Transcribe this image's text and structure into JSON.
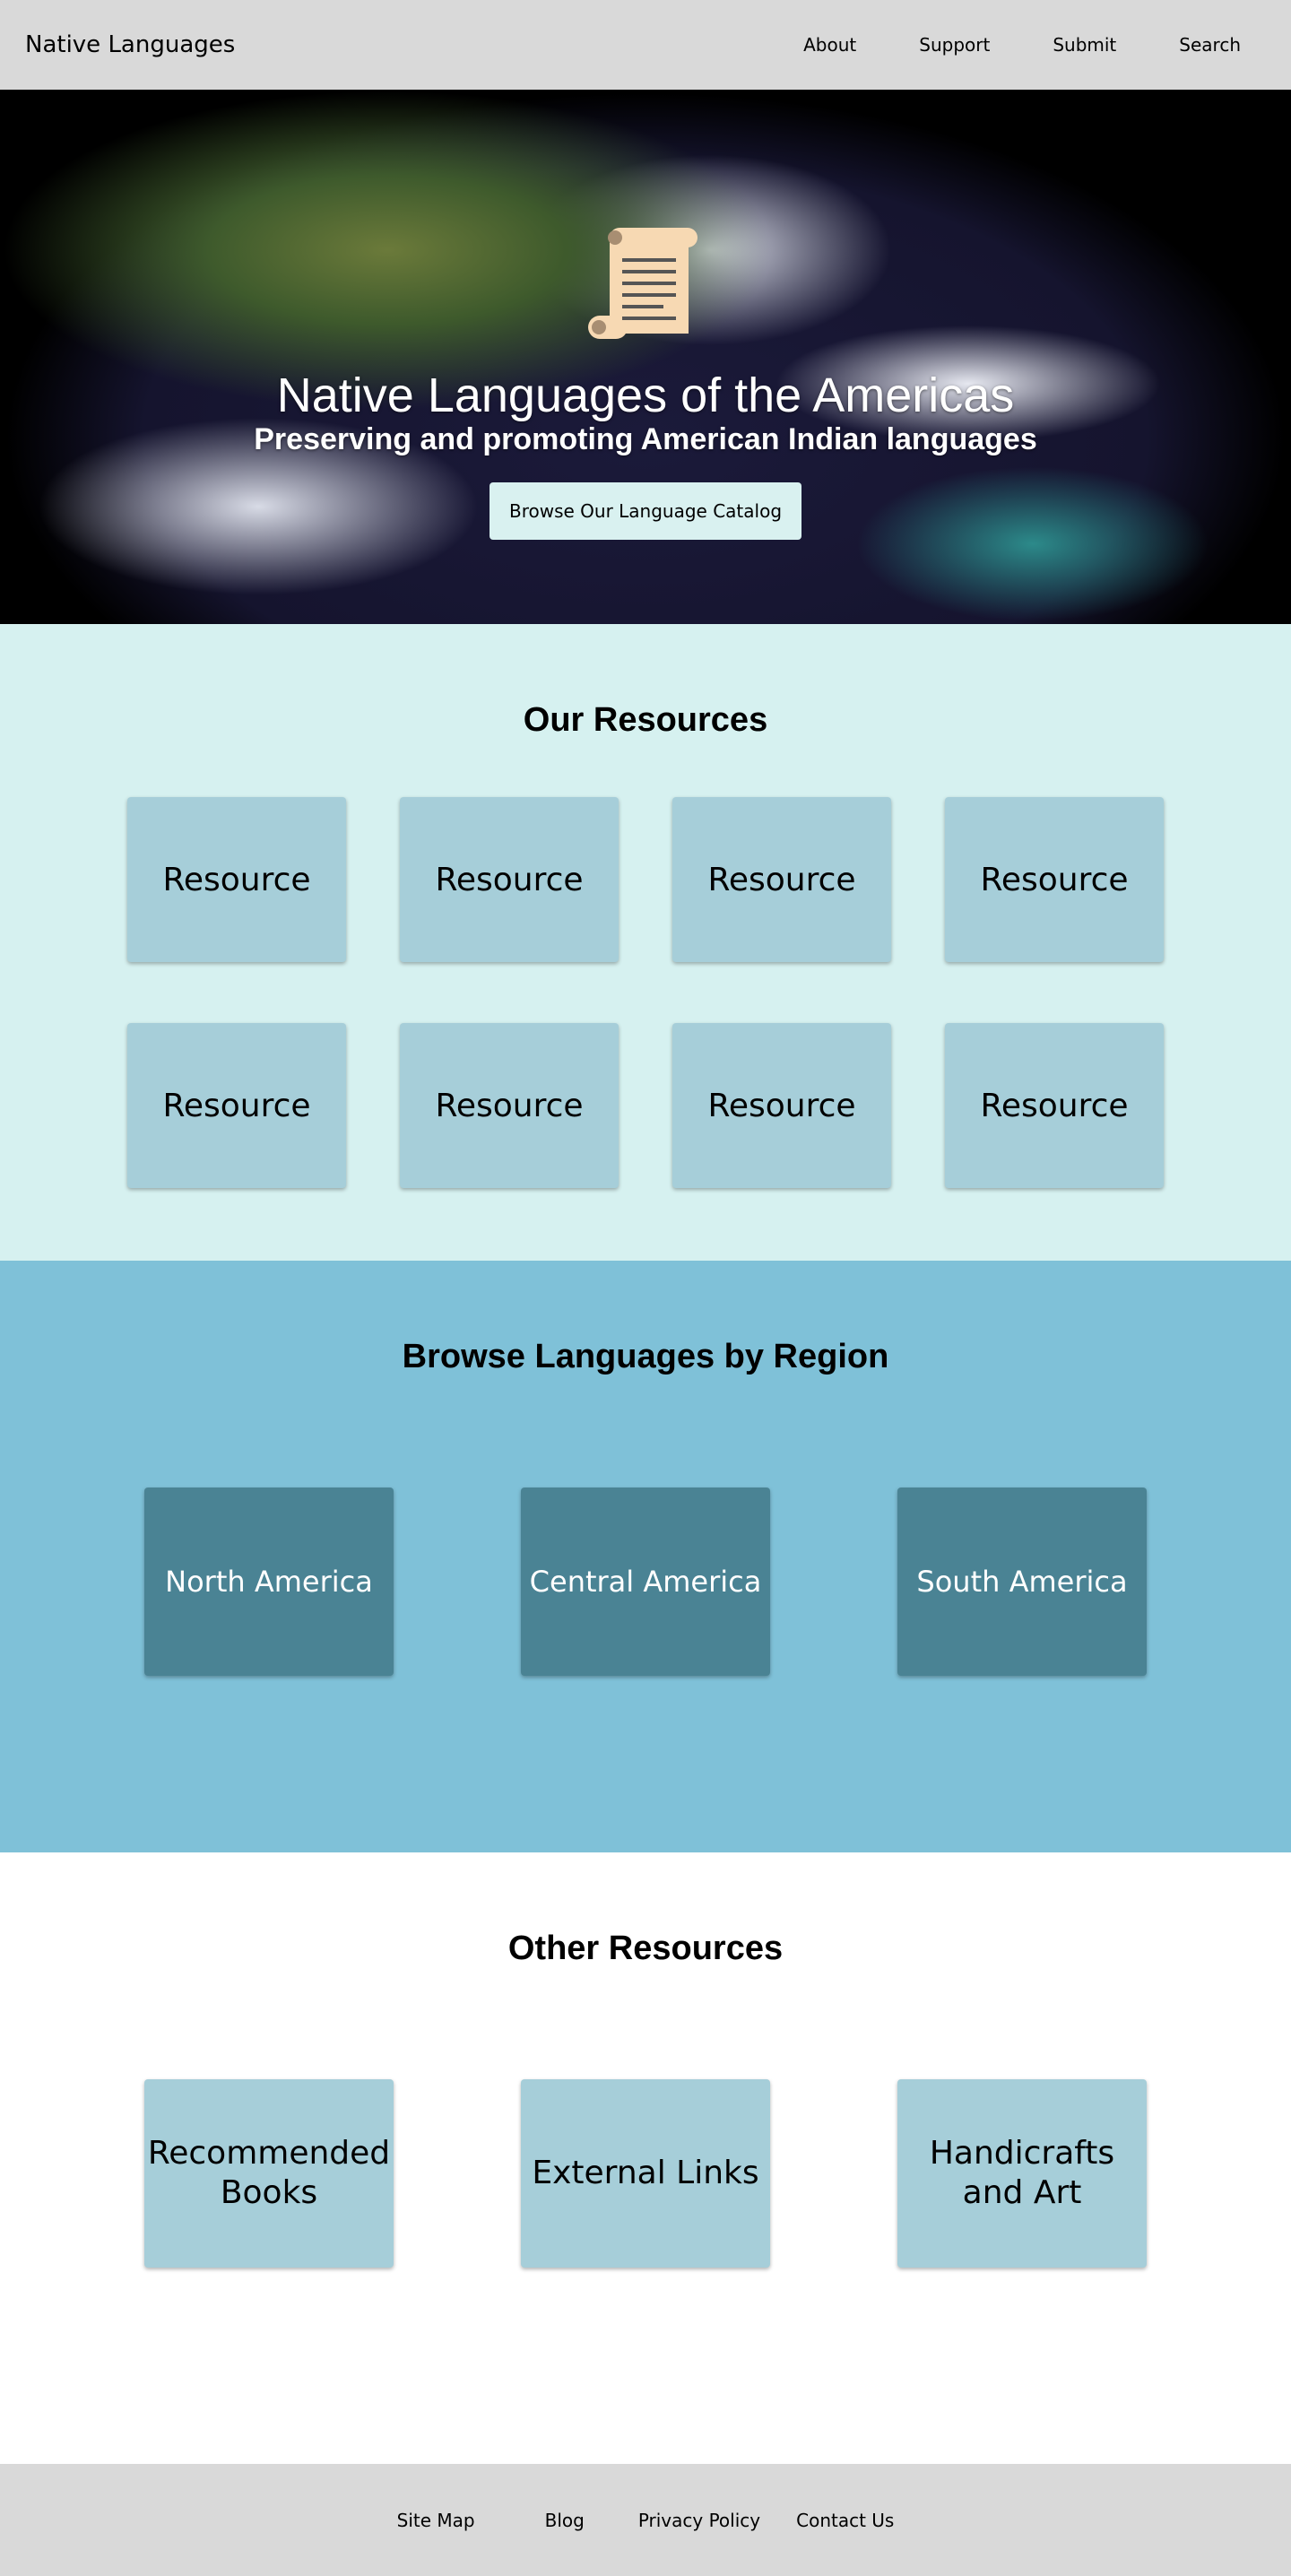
{
  "header": {
    "site_title": "Native Languages",
    "nav": [
      "About",
      "Support",
      "Submit",
      "Search"
    ]
  },
  "hero": {
    "icon": "scroll-icon",
    "title": "Native Languages of the Americas",
    "subtitle": "Preserving and promoting American Indian languages",
    "button_label": "Browse Our Language Catalog"
  },
  "resources": {
    "title": "Our Resources",
    "items": [
      "Resource",
      "Resource",
      "Resource",
      "Resource",
      "Resource",
      "Resource",
      "Resource",
      "Resource"
    ]
  },
  "regions": {
    "title": "Browse Languages by Region",
    "items": [
      "North America",
      "Central America",
      "South America"
    ]
  },
  "other": {
    "title": "Other Resources",
    "items": [
      "Recommended Books",
      "External Links",
      "Handicrafts and Art"
    ]
  },
  "footer": {
    "links": [
      "Site Map",
      "Blog",
      "Privacy Policy",
      "Contact Us"
    ]
  },
  "colors": {
    "header_bg": "#d9d9d9",
    "resources_bg": "#d6f1f0",
    "resource_card": "#a6ced9",
    "regions_bg": "#7fc1d8",
    "region_card": "#4a8394",
    "hero_button": "#d9f1f0"
  }
}
